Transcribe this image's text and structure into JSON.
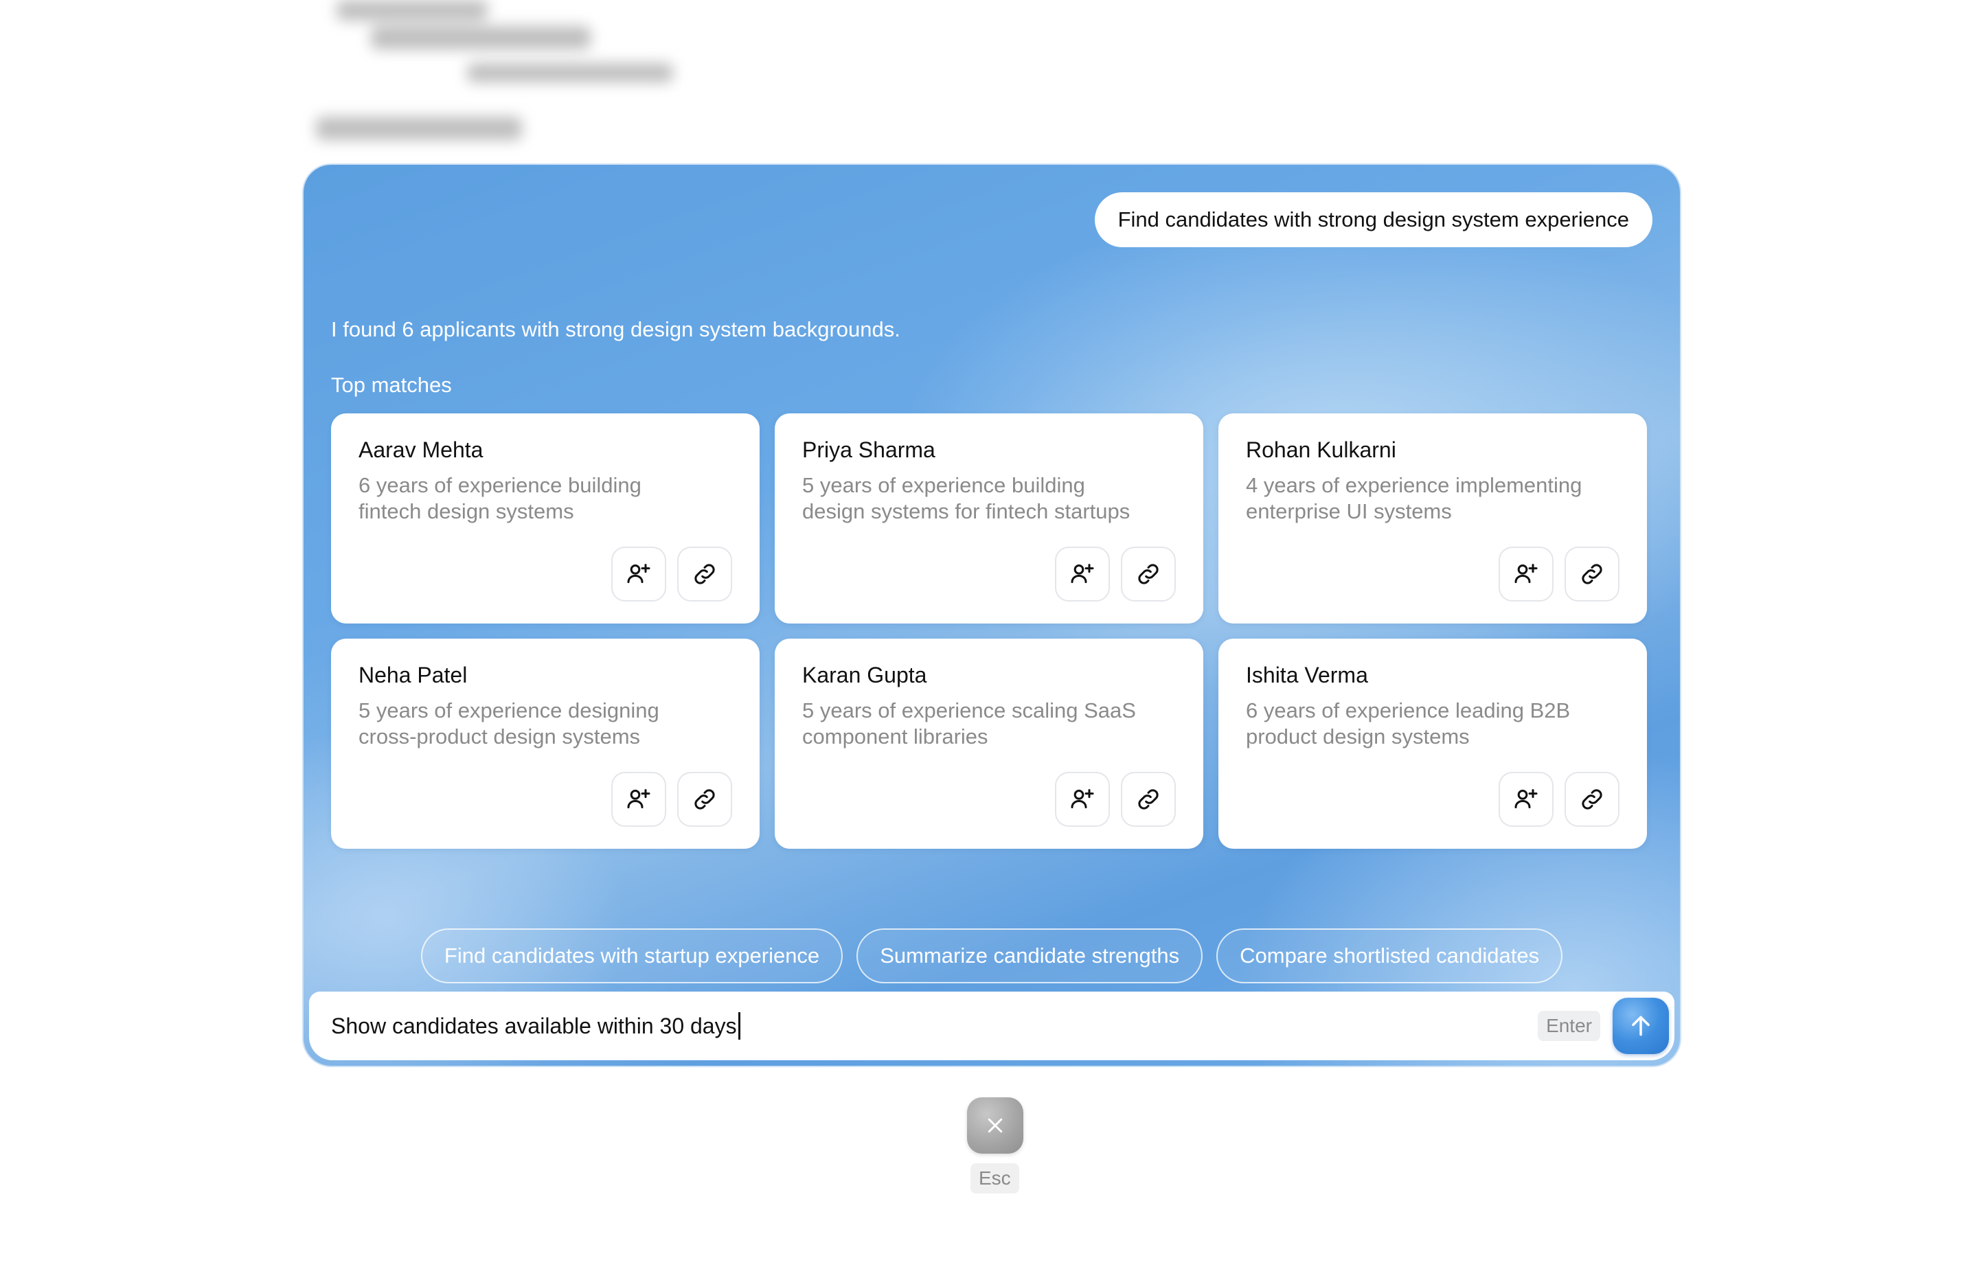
{
  "chat": {
    "user_prompt": "Find candidates with strong design system experience",
    "assistant_reply": "I found 6 applicants with strong design system backgrounds.",
    "section_label": "Top matches"
  },
  "candidates": [
    {
      "name": "Aarav Mehta",
      "description": "6 years of experience building fintech design systems"
    },
    {
      "name": "Priya Sharma",
      "description": "5 years of experience building design systems for fintech startups"
    },
    {
      "name": "Rohan Kulkarni",
      "description": "4 years of experience implementing enterprise UI systems"
    },
    {
      "name": "Neha Patel",
      "description": "5 years of experience designing cross-product design systems"
    },
    {
      "name": "Karan Gupta",
      "description": "5 years of experience scaling SaaS component libraries"
    },
    {
      "name": "Ishita Verma",
      "description": "6 years of experience leading B2B product design systems"
    }
  ],
  "card_actions": {
    "add_icon": "user-plus-icon",
    "link_icon": "link-icon"
  },
  "suggestions": [
    "Find candidates with startup experience",
    "Summarize candidate strengths",
    "Compare shortlisted candidates"
  ],
  "composer": {
    "value": "Show candidates available within 30 days",
    "enter_hint": "Enter",
    "send_icon": "arrow-up-icon"
  },
  "dismiss": {
    "close_icon": "close-icon",
    "esc_hint": "Esc"
  },
  "colors": {
    "panel_blue": "#5f9fe0",
    "send_blue": "#3f8fe0",
    "muted_text": "#8a8a8a"
  }
}
